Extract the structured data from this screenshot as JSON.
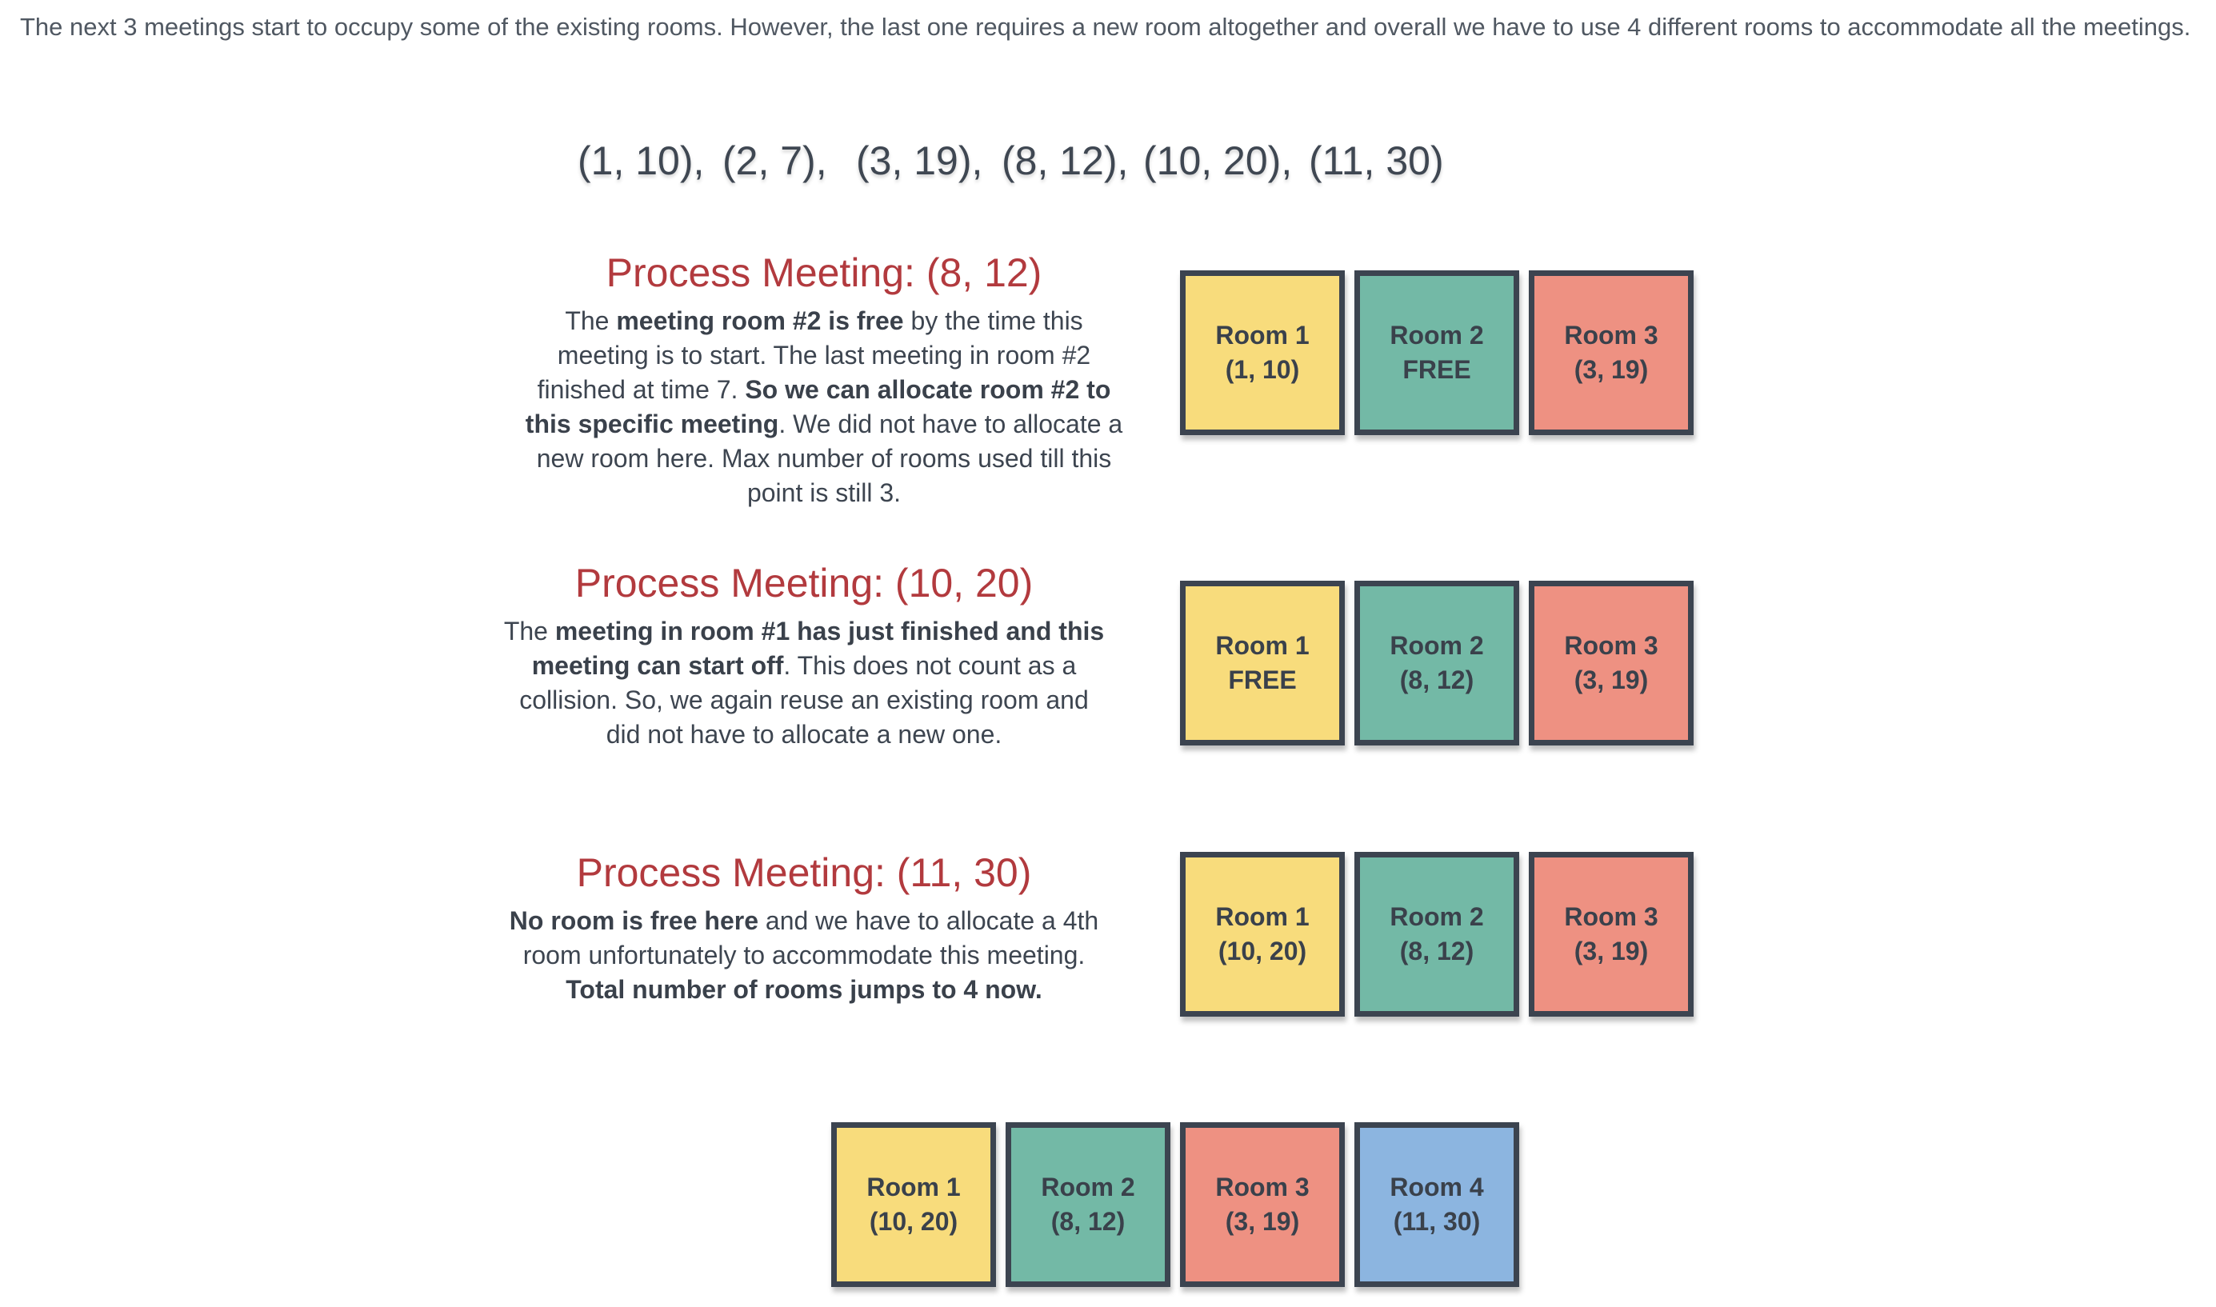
{
  "intro": "The next 3 meetings start to occupy some of the existing rooms. However, the last one requires a new room altogether and overall we have to use 4 different rooms to accommodate all the meetings.",
  "meetings": [
    "(1, 10),",
    "(2, 7),",
    "(3, 19),",
    "(8, 12),",
    "(10, 20),",
    "(11, 30)"
  ],
  "steps": [
    {
      "title": "Process Meeting:  (8, 12)",
      "desc": [
        {
          "t": "The ",
          "b": false
        },
        {
          "t": "meeting room #2 is free",
          "b": true
        },
        {
          "t": " by the time this meeting is to start. The last meeting in room #2 finished at time 7. ",
          "b": false
        },
        {
          "t": "So we can allocate room #2 to this specific meeting",
          "b": true
        },
        {
          "t": ". We did not have to allocate a new room here. Max number of rooms used till this point is still 3.",
          "b": false
        }
      ],
      "rooms": [
        {
          "name": "Room 1",
          "value": "(1, 10)",
          "color": "#f8dc7c"
        },
        {
          "name": "Room 2",
          "value": "FREE",
          "color": "#73b9a6"
        },
        {
          "name": "Room 3",
          "value": "(3, 19)",
          "color": "#ee9182"
        }
      ]
    },
    {
      "title": "Process Meeting:  (10, 20)",
      "desc": [
        {
          "t": "The ",
          "b": false
        },
        {
          "t": "meeting in room #1 has just finished and this meeting can start off",
          "b": true
        },
        {
          "t": ". This does not count as a collision. So, we again reuse an existing room and did not have to allocate a new one.",
          "b": false
        }
      ],
      "rooms": [
        {
          "name": "Room 1",
          "value": "FREE",
          "color": "#f8dc7c"
        },
        {
          "name": "Room 2",
          "value": "(8, 12)",
          "color": "#73b9a6"
        },
        {
          "name": "Room 3",
          "value": "(3, 19)",
          "color": "#ee9182"
        }
      ]
    },
    {
      "title": "Process Meeting:  (11, 30)",
      "desc": [
        {
          "t": "No room is free here",
          "b": true
        },
        {
          "t": " and we have to allocate a 4th room unfortunately to accommodate this meeting. ",
          "b": false
        },
        {
          "t": "Total number of rooms jumps to 4 now.",
          "b": true
        }
      ],
      "rooms": [
        {
          "name": "Room 1",
          "value": "(10, 20)",
          "color": "#f8dc7c"
        },
        {
          "name": "Room 2",
          "value": "(8, 12)",
          "color": "#73b9a6"
        },
        {
          "name": "Room 3",
          "value": "(3, 19)",
          "color": "#ee9182"
        }
      ]
    }
  ],
  "final_rooms": [
    {
      "name": "Room 1",
      "value": "(10, 20)",
      "color": "#f8dc7c"
    },
    {
      "name": "Room 2",
      "value": "(8, 12)",
      "color": "#73b9a6"
    },
    {
      "name": "Room 3",
      "value": "(3, 19)",
      "color": "#ee9182"
    },
    {
      "name": "Room 4",
      "value": "(11, 30)",
      "color": "#8cb5e0"
    }
  ]
}
